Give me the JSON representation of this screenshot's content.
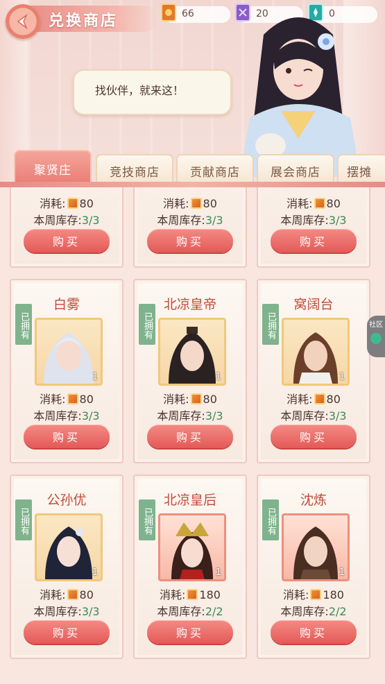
{
  "header": {
    "title": "兑换商店",
    "currencies": [
      {
        "icon": "orange-ticket-icon",
        "value": "66",
        "color": "#e07a2a"
      },
      {
        "icon": "purple-ticket-icon",
        "value": "20",
        "color": "#8a5cc6"
      },
      {
        "icon": "teal-ticket-icon",
        "value": "0",
        "color": "#2aa8a5"
      }
    ]
  },
  "dialog": {
    "text": "找伙伴，就来这！"
  },
  "tabs": [
    {
      "label": "聚贤庄",
      "active": true
    },
    {
      "label": "竞技商店",
      "active": false
    },
    {
      "label": "贡献商店",
      "active": false
    },
    {
      "label": "展会商店",
      "active": false
    },
    {
      "label": "摆摊",
      "active": false
    }
  ],
  "labels": {
    "cost": "消耗:",
    "stock": "本周库存:",
    "buy": "购买",
    "owned": "已拥有",
    "side": "社区"
  },
  "items": [
    {
      "name": "",
      "owned": false,
      "cost": "80",
      "stock": "3/3",
      "count": "",
      "rare": false
    },
    {
      "name": "",
      "owned": false,
      "cost": "80",
      "stock": "3/3",
      "count": "",
      "rare": false
    },
    {
      "name": "",
      "owned": false,
      "cost": "80",
      "stock": "3/3",
      "count": "",
      "rare": false
    },
    {
      "name": "白雾",
      "owned": true,
      "cost": "80",
      "stock": "3/3",
      "count": "1",
      "rare": false
    },
    {
      "name": "北凉皇帝",
      "owned": true,
      "cost": "80",
      "stock": "3/3",
      "count": "1",
      "rare": false
    },
    {
      "name": "窝阔台",
      "owned": true,
      "cost": "80",
      "stock": "3/3",
      "count": "1",
      "rare": false
    },
    {
      "name": "公孙优",
      "owned": true,
      "cost": "80",
      "stock": "3/3",
      "count": "1",
      "rare": false
    },
    {
      "name": "北凉皇后",
      "owned": true,
      "cost": "180",
      "stock": "2/2",
      "count": "1",
      "rare": true
    },
    {
      "name": "沈炼",
      "owned": true,
      "cost": "180",
      "stock": "2/2",
      "count": "1",
      "rare": true
    }
  ]
}
